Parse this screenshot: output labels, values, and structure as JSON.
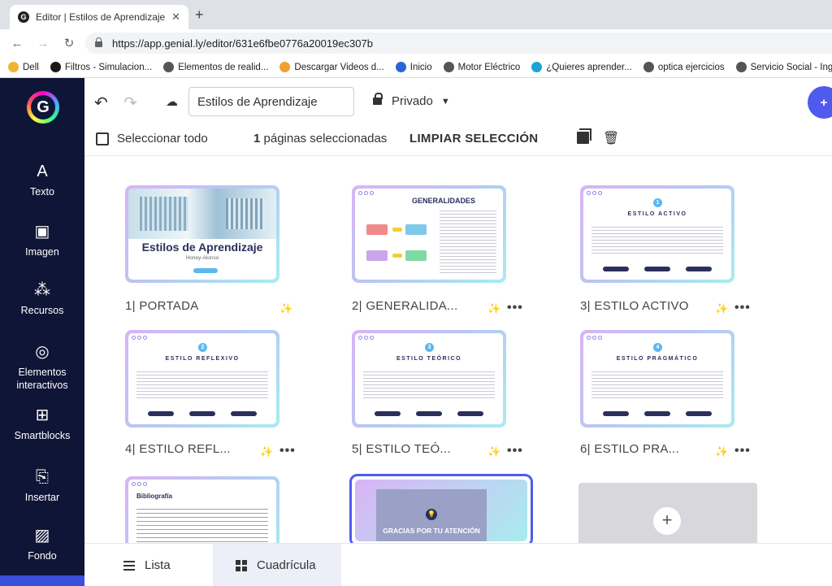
{
  "browser": {
    "tab_title": "Editor | Estilos de Aprendizaje",
    "url": "https://app.genial.ly/editor/631e6fbe0776a20019ec307b",
    "bookmarks": [
      {
        "label": "Dell",
        "color": "#f2b233"
      },
      {
        "label": "Filtros - Simulacion...",
        "color": "#1a1a1a"
      },
      {
        "label": "Elementos de realid...",
        "color": "#555555"
      },
      {
        "label": "Descargar Videos d...",
        "color": "#f0a030"
      },
      {
        "label": "Inicio",
        "color": "#2b63d9"
      },
      {
        "label": "Motor Eléctrico",
        "color": "#555555"
      },
      {
        "label": "¿Quieres aprender...",
        "color": "#1aa3d9"
      },
      {
        "label": "optica ejercicios",
        "color": "#555555"
      },
      {
        "label": "Servicio Social - Ing...",
        "color": "#555555"
      }
    ]
  },
  "sidebar": {
    "logo": "G",
    "items": [
      {
        "label": "Texto",
        "icon": "A"
      },
      {
        "label": "Imagen",
        "icon": "▣"
      },
      {
        "label": "Recursos",
        "icon": "⁂"
      },
      {
        "label": "Elementos interactivos",
        "icon": "◎"
      },
      {
        "label": "Smartblocks",
        "icon": "⊞"
      },
      {
        "label": "Insertar",
        "icon": "⎘"
      },
      {
        "label": "Fondo",
        "icon": "▨"
      }
    ]
  },
  "toolbar": {
    "title_value": "Estilos de Aprendizaje",
    "privacy_label": "Privado"
  },
  "selection": {
    "select_all_label": "Seleccionar todo",
    "count": "1",
    "count_suffix": "páginas seleccionadas",
    "clear_label": "LIMPIAR SELECCIÓN"
  },
  "pages": [
    {
      "num": "1",
      "label": "PORTADA"
    },
    {
      "num": "2",
      "label": "GENERALIDA..."
    },
    {
      "num": "3",
      "label": "ESTILO ACTIVO"
    },
    {
      "num": "4",
      "label": "ESTILO REFL..."
    },
    {
      "num": "5",
      "label": "ESTILO TEÓ..."
    },
    {
      "num": "6",
      "label": "ESTILO PRA..."
    }
  ],
  "thumbs": {
    "cover_title": "Estilos de Aprendizaje",
    "cover_sub": "Honey-Alonso",
    "gen_title": "GENERALIDADES",
    "t3": {
      "n": "1",
      "title": "ESTILO ACTIVO"
    },
    "t4": {
      "n": "2",
      "title": "ESTILO REFLEXIVO"
    },
    "t5": {
      "n": "3",
      "title": "ESTILO TEÓRICO"
    },
    "t6": {
      "n": "4",
      "title": "ESTILO PRAGMÁTICO"
    },
    "biblio_title": "Bibliografía",
    "final_text": "GRACIAS POR TU ATENCIÓN"
  },
  "views": {
    "list_label": "Lista",
    "grid_label": "Cuadrícula"
  }
}
